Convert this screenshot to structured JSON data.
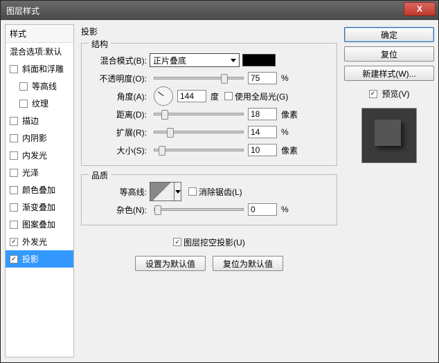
{
  "window": {
    "title": "图层样式",
    "close": "X"
  },
  "sidebar": {
    "header": "样式",
    "blending": "混合选项:默认",
    "items": [
      {
        "label": "斜面和浮雕",
        "checked": false,
        "indent": false
      },
      {
        "label": "等高线",
        "checked": false,
        "indent": true
      },
      {
        "label": "纹理",
        "checked": false,
        "indent": true
      },
      {
        "label": "描边",
        "checked": false,
        "indent": false
      },
      {
        "label": "内阴影",
        "checked": false,
        "indent": false
      },
      {
        "label": "内发光",
        "checked": false,
        "indent": false
      },
      {
        "label": "光泽",
        "checked": false,
        "indent": false
      },
      {
        "label": "颜色叠加",
        "checked": false,
        "indent": false
      },
      {
        "label": "渐变叠加",
        "checked": false,
        "indent": false
      },
      {
        "label": "图案叠加",
        "checked": false,
        "indent": false
      },
      {
        "label": "外发光",
        "checked": true,
        "indent": false
      },
      {
        "label": "投影",
        "checked": true,
        "indent": false,
        "selected": true
      }
    ]
  },
  "main": {
    "title": "投影",
    "structure": {
      "legend": "结构",
      "blend_label": "混合模式(B):",
      "blend_value": "正片叠底",
      "color": "#000000",
      "opacity_label": "不透明度(O):",
      "opacity_value": "75",
      "opacity_unit": "%",
      "angle_label": "角度(A):",
      "angle_value": "144",
      "angle_unit": "度",
      "global_label": "使用全局光(G)",
      "global_checked": false,
      "distance_label": "距离(D):",
      "distance_value": "18",
      "distance_unit": "像素",
      "spread_label": "扩展(R):",
      "spread_value": "14",
      "spread_unit": "%",
      "size_label": "大小(S):",
      "size_value": "10",
      "size_unit": "像素"
    },
    "quality": {
      "legend": "品质",
      "contour_label": "等高线:",
      "antialias_label": "消除锯齿(L)",
      "antialias_checked": false,
      "noise_label": "杂色(N):",
      "noise_value": "0",
      "noise_unit": "%"
    },
    "knockout_label": "图层挖空投影(U)",
    "knockout_checked": true,
    "btn_default": "设置为默认值",
    "btn_reset": "复位为默认值"
  },
  "right": {
    "ok": "确定",
    "cancel": "复位",
    "newstyle": "新建样式(W)...",
    "preview_label": "预览(V)",
    "preview_checked": true
  }
}
